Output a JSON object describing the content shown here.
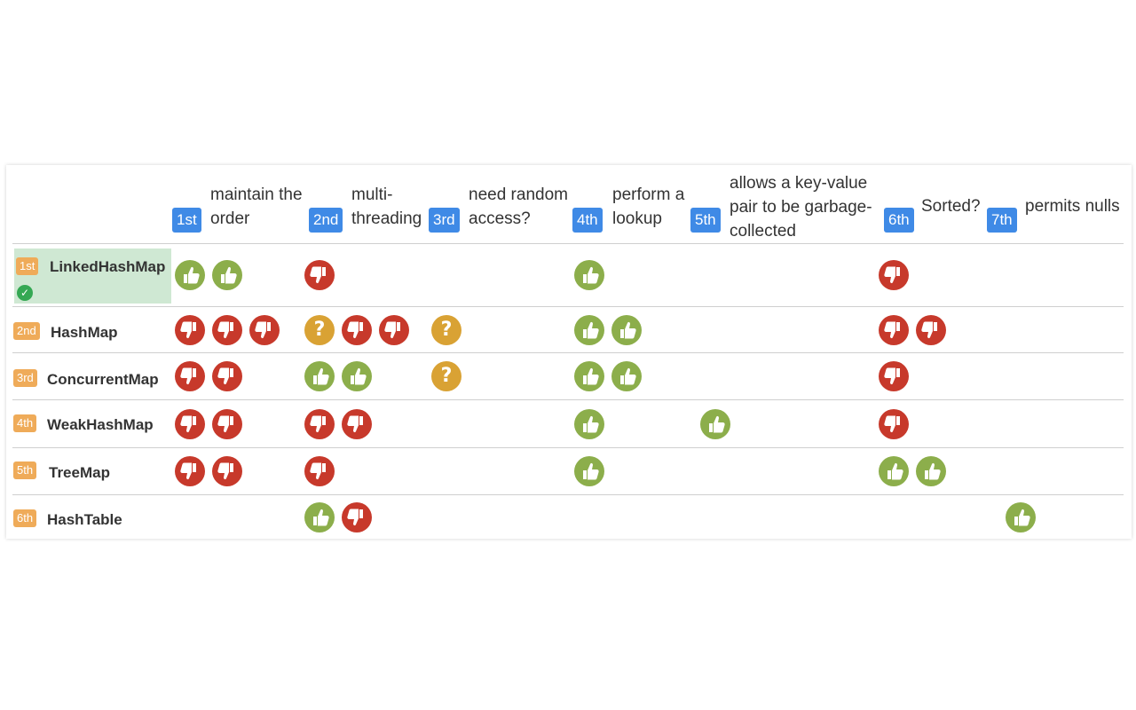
{
  "criteria": [
    {
      "rank": "1st",
      "label": "maintain the order"
    },
    {
      "rank": "2nd",
      "label": "multi-threading"
    },
    {
      "rank": "3rd",
      "label": "need random access?"
    },
    {
      "rank": "4th",
      "label": "perform a lookup"
    },
    {
      "rank": "5th",
      "label": "allows a key-value pair to be garbage-collected"
    },
    {
      "rank": "6th",
      "label": "Sorted?"
    },
    {
      "rank": "7th",
      "label": "permits nulls"
    }
  ],
  "options": [
    {
      "rank": "1st",
      "name": "LinkedHashMap",
      "selected": true,
      "ratings": [
        [
          "up",
          "up"
        ],
        [
          "down"
        ],
        [],
        [
          "up"
        ],
        [],
        [
          "down"
        ],
        []
      ]
    },
    {
      "rank": "2nd",
      "name": "HashMap",
      "selected": false,
      "ratings": [
        [
          "down",
          "down",
          "down"
        ],
        [
          "maybe",
          "down",
          "down"
        ],
        [
          "maybe"
        ],
        [
          "up",
          "up"
        ],
        [],
        [
          "down",
          "down"
        ],
        []
      ]
    },
    {
      "rank": "3rd",
      "name": "ConcurrentMap",
      "selected": false,
      "ratings": [
        [
          "down",
          "down"
        ],
        [
          "up",
          "up"
        ],
        [
          "maybe"
        ],
        [
          "up",
          "up"
        ],
        [],
        [
          "down"
        ],
        []
      ]
    },
    {
      "rank": "4th",
      "name": "WeakHashMap",
      "selected": false,
      "ratings": [
        [
          "down",
          "down"
        ],
        [
          "down",
          "down"
        ],
        [],
        [
          "up"
        ],
        [
          "up"
        ],
        [
          "down"
        ],
        []
      ]
    },
    {
      "rank": "5th",
      "name": "TreeMap",
      "selected": false,
      "ratings": [
        [
          "down",
          "down"
        ],
        [
          "down"
        ],
        [],
        [
          "up"
        ],
        [],
        [
          "up",
          "up"
        ],
        []
      ]
    },
    {
      "rank": "6th",
      "name": "HashTable",
      "selected": false,
      "ratings": [
        [],
        [
          "up",
          "down"
        ],
        [],
        [],
        [],
        [],
        [
          "up"
        ]
      ]
    }
  ],
  "icons": {
    "up": "thumbs-up-icon",
    "down": "thumbs-down-icon",
    "maybe": "question-icon",
    "check": "check-circle-icon"
  },
  "colors": {
    "up": "#8cae4b",
    "down": "#c7392b",
    "maybe": "#d9a234",
    "criterion_badge": "#3f8ae6",
    "option_badge": "#efab59",
    "selected_row": "#cfe8d3"
  }
}
